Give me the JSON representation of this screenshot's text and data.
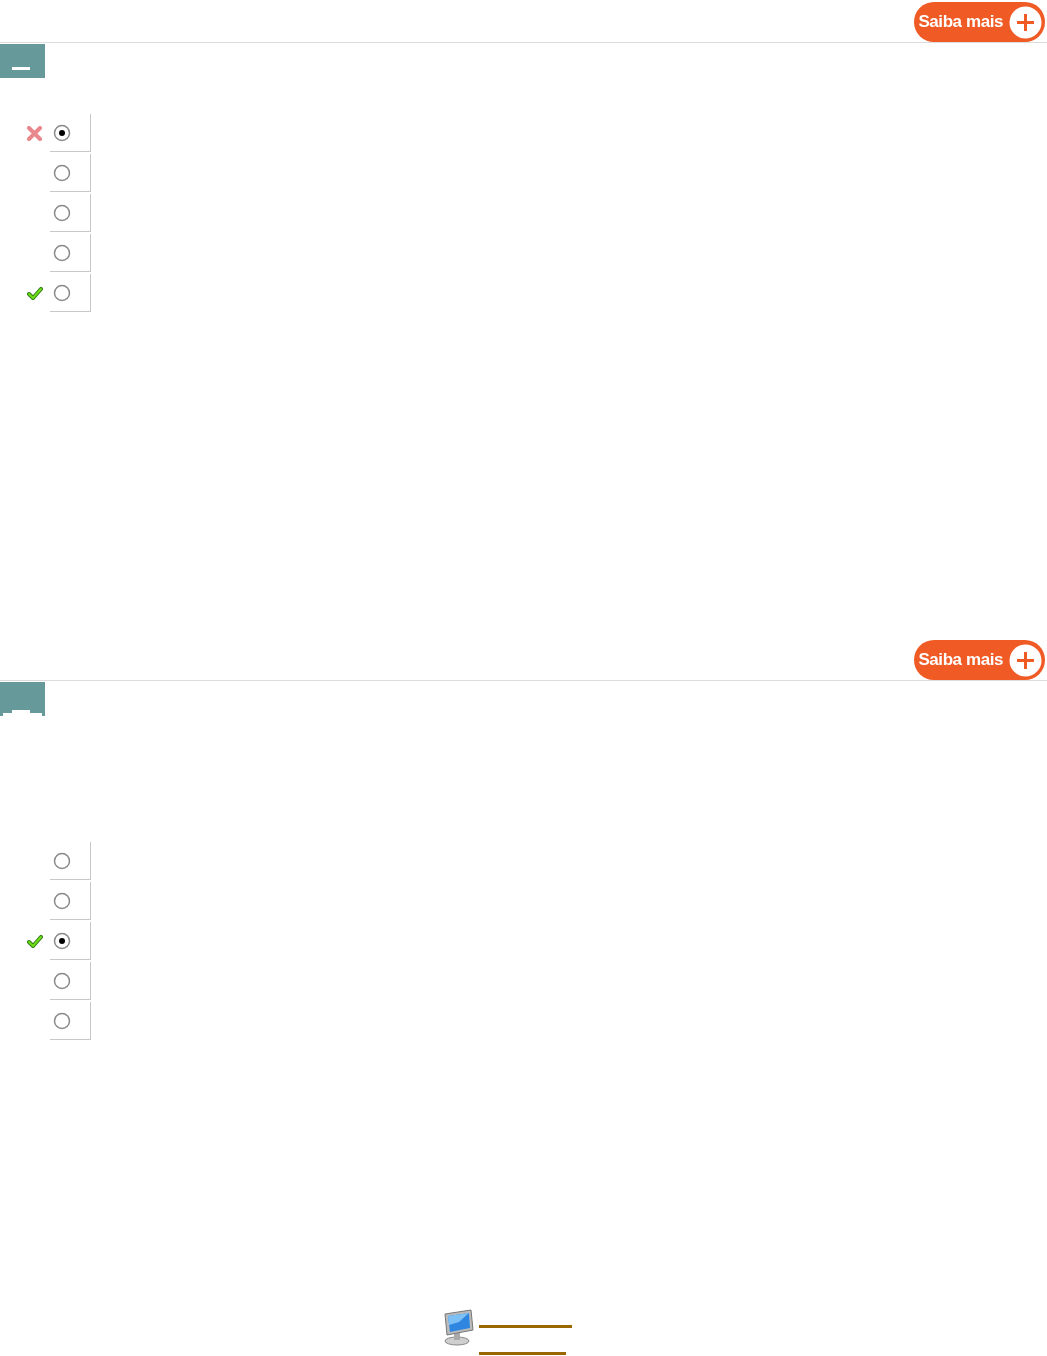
{
  "questions": [
    {
      "more_button": "Saiba mais",
      "badge": {
        "kind": "dash"
      },
      "options": [
        {
          "selected": true,
          "correct": false,
          "wrong": true
        },
        {
          "selected": false,
          "correct": false,
          "wrong": false
        },
        {
          "selected": false,
          "correct": false,
          "wrong": false
        },
        {
          "selected": false,
          "correct": false,
          "wrong": false
        },
        {
          "selected": false,
          "correct": true,
          "wrong": false
        }
      ]
    },
    {
      "more_button": "Saiba mais",
      "badge": {
        "kind": "base"
      },
      "options": [
        {
          "selected": false,
          "correct": false,
          "wrong": false
        },
        {
          "selected": false,
          "correct": false,
          "wrong": false
        },
        {
          "selected": true,
          "correct": true,
          "wrong": false
        },
        {
          "selected": false,
          "correct": false,
          "wrong": false
        },
        {
          "selected": false,
          "correct": false,
          "wrong": false
        }
      ]
    }
  ]
}
